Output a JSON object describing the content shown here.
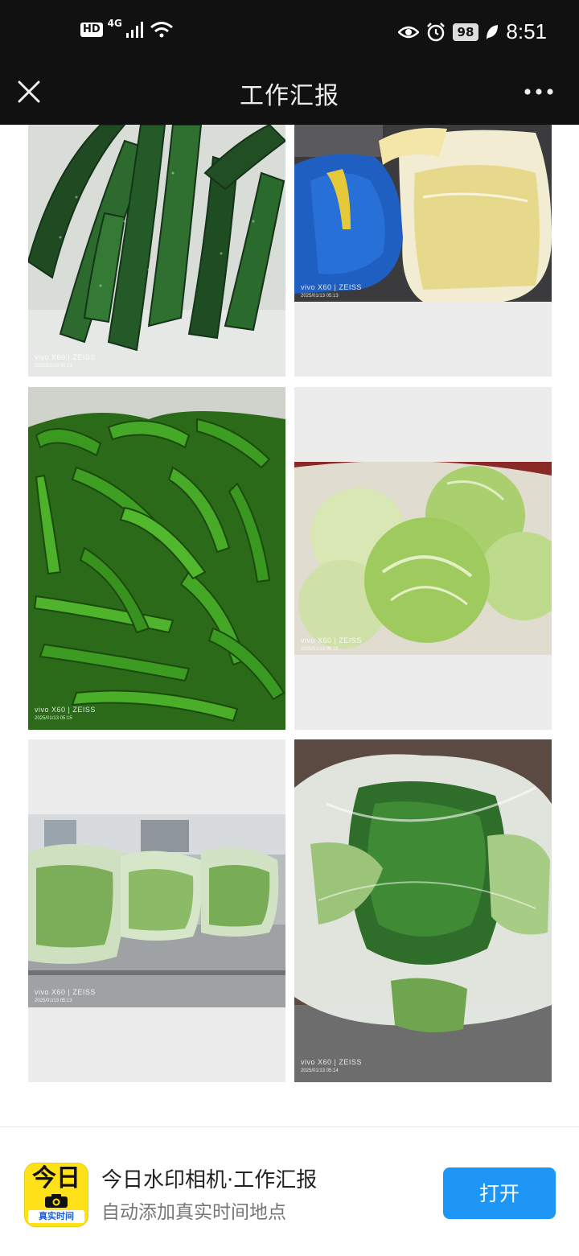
{
  "status_bar": {
    "hd": "HD",
    "network": "4G",
    "battery": "98",
    "time": "8:51"
  },
  "header": {
    "title": "工作汇报",
    "close_icon": "close-icon",
    "more_icon": "more-dots-icon"
  },
  "photos": [
    {
      "subject": "cucumbers",
      "brand": "vivo X60 | ZEISS",
      "date": "2025/01/13 05:13"
    },
    {
      "subject": "bagged corn kernels",
      "brand": "vivo X60 | ZEISS",
      "date": "2025/01/13 05:13"
    },
    {
      "subject": "green peppers",
      "brand": "vivo X60 | ZEISS",
      "date": "2025/01/13 05:15"
    },
    {
      "subject": "cabbages in bag",
      "brand": "vivo X60 | ZEISS",
      "date": "2025/01/13 05:15"
    },
    {
      "subject": "bagged greens on counter",
      "brand": "vivo X60 | ZEISS",
      "date": "2025/01/13 05:13"
    },
    {
      "subject": "leafy greens in plastic bag",
      "brand": "vivo X60 | ZEISS",
      "date": "2025/01/13 05:14"
    }
  ],
  "banner": {
    "icon_big": "今日",
    "icon_strip": "真实时间",
    "app_name": "今日水印相机·工作汇报",
    "app_desc": "自动添加真实时间地点",
    "open_label": "打开"
  },
  "colors": {
    "top_bar": "#111111",
    "open_button": "#1e96f5",
    "app_icon": "#ffe11a"
  }
}
